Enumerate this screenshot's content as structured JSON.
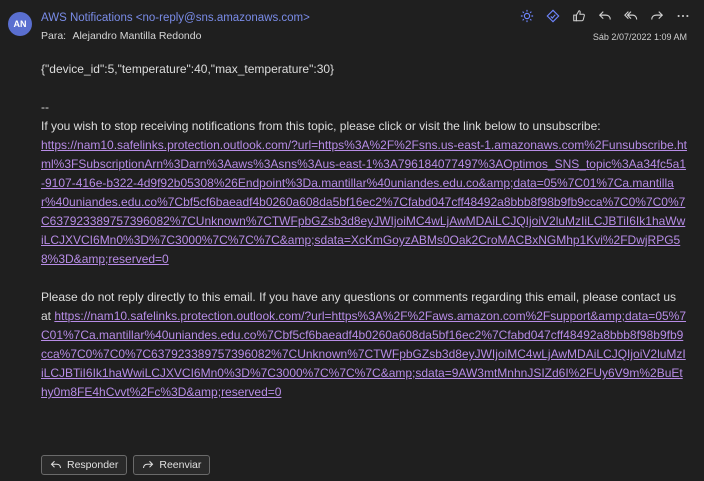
{
  "header": {
    "avatar_initials": "AN",
    "sender": "AWS Notifications <no-reply@sns.amazonaws.com>",
    "to_label": "Para:",
    "to_value": "Alejandro Mantilla Redondo",
    "date": "Sáb 2/07/2022 1:09 AM",
    "action_icons": [
      "sun-icon",
      "sticker-icon",
      "like-icon",
      "reply-icon",
      "reply-all-icon",
      "forward-icon",
      "more-icon"
    ]
  },
  "body": {
    "json_line": "{\"device_id\":5,\"temperature\":40,\"max_temperature\":30}",
    "separator": "--",
    "unsubscribe_text": "If you wish to stop receiving notifications from this topic, please click or visit the link below to unsubscribe:",
    "unsubscribe_link": "https://nam10.safelinks.protection.outlook.com/?url=https%3A%2F%2Fsns.us-east-1.amazonaws.com%2Funsubscribe.html%3FSubscriptionArn%3Darn%3Aaws%3Asns%3Aus-east-1%3A796184077497%3AOptimos_SNS_topic%3Aa34fc5a1-9107-416e-b322-4d9f92b05308%26Endpoint%3Da.mantillar%40uniandes.edu.co&amp;data=05%7C01%7Ca.mantillar%40uniandes.edu.co%7Cbf5cf6baeadf4b0260a608da5bf16ec2%7Cfabd047cff48492a8bbb8f98b9fb9cca%7C0%7C0%7C637923389757396082%7CUnknown%7CTWFpbGZsb3d8eyJWIjoiMC4wLjAwMDAiLCJQIjoiV2luMzIiLCJBTiI6Ik1haWwiLCJXVCI6Mn0%3D%7C3000%7C%7C%7C&amp;sdata=XcKmGoyzABMs0Oak2CroMACBxNGMhp1Kvi%2FDwjRPG58%3D&amp;reserved=0",
    "contact_text": "Please do not reply directly to this email. If you have any questions or comments regarding this email, please contact us at ",
    "contact_link": "https://nam10.safelinks.protection.outlook.com/?url=https%3A%2F%2Faws.amazon.com%2Fsupport&amp;data=05%7C01%7Ca.mantillar%40uniandes.edu.co%7Cbf5cf6baeadf4b0260a608da5bf16ec2%7Cfabd047cff48492a8bbb8f98b9fb9cca%7C0%7C0%7C637923389757396082%7CUnknown%7CTWFpbGZsb3d8eyJWIjoiMC4wLjAwMDAiLCJQIjoiV2luMzIiLCJBTiI6Ik1haWwiLCJXVCI6Mn0%3D%7C3000%7C%7C%7C&amp;sdata=9AW3mtMnhnJSIZd6I%2FUy6V9m%2BuEthy0m8FE4hCvvt%2Fc%3D&amp;reserved=0"
  },
  "footer": {
    "reply_label": "Responder",
    "forward_label": "Reenviar"
  },
  "colors": {
    "background": "#1f1f1f",
    "sender": "#7a8ce8",
    "link": "#b78ce6",
    "avatar": "#5a6fd0",
    "accent_icon": "#6f86ff"
  }
}
